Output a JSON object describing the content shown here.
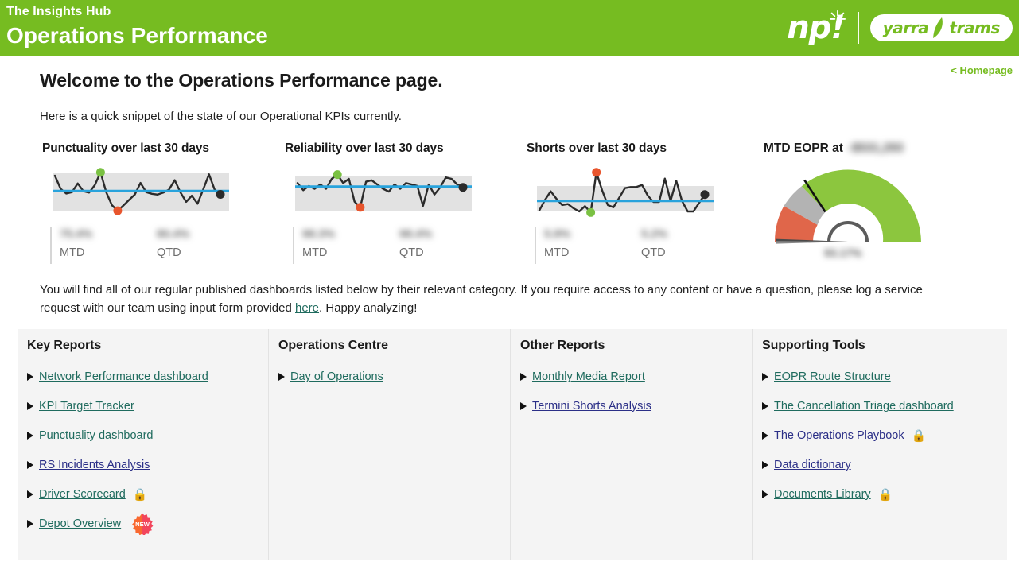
{
  "header": {
    "subtitle": "The Insights Hub",
    "title": "Operations Performance",
    "brand_np": "np",
    "brand_np_bang": "!",
    "brand_yarra": "yarra",
    "brand_trams": "trams",
    "brand_color": "#76bc21"
  },
  "homepage_link": "< Homepage",
  "welcome": {
    "title": "Welcome to the Operations Performance page.",
    "subtitle": "Here is a quick snippet of the state of our Operational KPIs currently."
  },
  "intro": {
    "part1": "You will find all of our regular published dashboards listed below by their relevant category. If you require access to any content or have a question, please log a service request with our team using input form provided ",
    "link": "here",
    "part2": ". Happy analyzing!"
  },
  "kpi_cards": [
    {
      "title": "Punctuality over last 30 days",
      "mtd_value": "75.4%",
      "mtd_label": "MTD",
      "qtd_value": "80.4%",
      "qtd_label": "QTD"
    },
    {
      "title": "Reliability over last 30 days",
      "mtd_value": "98.3%",
      "mtd_label": "MTD",
      "qtd_value": "98.4%",
      "qtd_label": "QTD"
    },
    {
      "title": "Shorts over last 30 days",
      "mtd_value": "5.9%",
      "mtd_label": "MTD",
      "qtd_value": "5.2%",
      "qtd_label": "QTD"
    }
  ],
  "gauge": {
    "title": "MTD EOPR at",
    "amount": "-$531,293",
    "percent": "93.17%"
  },
  "chart_data": [
    {
      "type": "line",
      "title": "Punctuality over last 30 days",
      "xlabel": "",
      "ylabel": "",
      "grid": false,
      "legend": "none",
      "reference_line": 78.5,
      "ylim": [
        70,
        86
      ],
      "x": [
        1,
        2,
        3,
        4,
        5,
        6,
        7,
        8,
        9,
        10,
        11,
        12,
        13,
        14,
        15,
        16,
        17,
        18,
        19,
        20,
        21,
        22,
        23,
        24,
        25,
        26,
        27,
        28,
        29,
        30
      ],
      "values": [
        84.0,
        79.3,
        77.6,
        78.1,
        81.2,
        78.4,
        77.9,
        80.6,
        85.2,
        78.0,
        73.4,
        71.4,
        73.3,
        75.3,
        77.2,
        81.4,
        78.1,
        77.5,
        77.2,
        77.9,
        79.0,
        82.4,
        78.0,
        74.6,
        76.8,
        73.9,
        79.1,
        84.5,
        79.0,
        77.3
      ],
      "markers": {
        "max_index": 9,
        "max_color": "#7ac143",
        "min_index": 12,
        "min_color": "#e8552d",
        "last_index": 30,
        "last_color": "#2b2b2b"
      },
      "mtd": "75.4%",
      "qtd": "80.4%"
    },
    {
      "type": "line",
      "title": "Reliability over last 30 days",
      "xlabel": "",
      "ylabel": "",
      "grid": false,
      "legend": "none",
      "reference_line": 98.35,
      "ylim": [
        96.5,
        99.4
      ],
      "x": [
        1,
        2,
        3,
        4,
        5,
        6,
        7,
        8,
        9,
        10,
        11,
        12,
        13,
        14,
        15,
        16,
        17,
        18,
        19,
        20,
        21,
        22,
        23,
        24,
        25,
        26,
        27,
        28,
        29,
        30
      ],
      "values": [
        98.6,
        98.1,
        98.4,
        98.2,
        98.5,
        98.2,
        98.9,
        99.2,
        98.6,
        98.9,
        97.3,
        96.9,
        98.7,
        98.8,
        98.5,
        98.2,
        98.0,
        98.5,
        98.2,
        98.6,
        98.5,
        98.4,
        97.0,
        98.5,
        97.8,
        98.3,
        99.0,
        98.9,
        98.5,
        98.3
      ],
      "markers": {
        "max_index": 8,
        "max_color": "#7ac143",
        "min_index": 12,
        "min_color": "#e8552d",
        "last_index": 30,
        "last_color": "#2b2b2b"
      },
      "mtd": "98.3%",
      "qtd": "98.4%"
    },
    {
      "type": "line",
      "title": "Shorts over last 30 days",
      "xlabel": "",
      "ylabel": "",
      "grid": false,
      "legend": "none",
      "reference_line": 5.3,
      "ylim": [
        4.0,
        8.2
      ],
      "x": [
        1,
        2,
        3,
        4,
        5,
        6,
        7,
        8,
        9,
        10,
        11,
        12,
        13,
        14,
        15,
        16,
        17,
        18,
        19,
        20,
        21,
        22,
        23,
        24,
        25,
        26,
        27,
        28,
        29,
        30
      ],
      "values": [
        4.4,
        5.4,
        6.2,
        5.5,
        4.9,
        5.0,
        4.6,
        4.3,
        4.8,
        4.2,
        8.0,
        6.3,
        4.9,
        4.7,
        5.6,
        6.5,
        6.6,
        6.6,
        6.8,
        5.8,
        5.2,
        5.2,
        7.4,
        5.3,
        7.2,
        5.3,
        4.3,
        4.3,
        5.1,
        5.9
      ],
      "markers": {
        "max_index": 11,
        "max_color": "#e8552d",
        "min_index": 10,
        "min_color": "#7ac143",
        "last_index": 30,
        "last_color": "#2b2b2b"
      },
      "mtd": "5.9%",
      "qtd": "5.2%"
    },
    {
      "type": "gauge",
      "title": "MTD EOPR at",
      "value_label": "93.17%",
      "amount_label": "-$531,293",
      "segments": [
        {
          "name": "poor",
          "color": "#e0664a",
          "from": 0,
          "to": 13
        },
        {
          "name": "warn",
          "color": "#b3b3b3",
          "from": 13,
          "to": 24
        },
        {
          "name": "good",
          "color": "#8cc63e",
          "from": 24,
          "to": 100
        }
      ],
      "needle_value": 1.5,
      "target_value": 67
    }
  ],
  "columns": [
    {
      "heading": "Key Reports",
      "links": [
        {
          "label": "Network Performance dashboard",
          "style": "green",
          "badge": "none"
        },
        {
          "label": "KPI Target Tracker",
          "style": "green",
          "badge": "none"
        },
        {
          "label": "Punctuality dashboard",
          "style": "green",
          "badge": "none"
        },
        {
          "label": "RS Incidents Analysis",
          "style": "navy",
          "badge": "none"
        },
        {
          "label": "Driver Scorecard",
          "style": "green",
          "badge": "lock"
        },
        {
          "label": "Depot Overview",
          "style": "green",
          "badge": "new"
        }
      ]
    },
    {
      "heading": "Operations Centre",
      "links": [
        {
          "label": "Day of Operations",
          "style": "green",
          "badge": "none"
        }
      ]
    },
    {
      "heading": "Other Reports",
      "links": [
        {
          "label": "Monthly Media Report",
          "style": "green",
          "badge": "none"
        },
        {
          "label": "Termini Shorts Analysis",
          "style": "navy",
          "badge": "none"
        }
      ]
    },
    {
      "heading": "Supporting Tools",
      "links": [
        {
          "label": "EOPR Route Structure",
          "style": "green",
          "badge": "none"
        },
        {
          "label": "The Cancellation Triage dashboard",
          "style": "green",
          "badge": "none"
        },
        {
          "label": "The Operations Playbook",
          "style": "navy",
          "badge": "lock"
        },
        {
          "label": "Data dictionary",
          "style": "navy",
          "badge": "none"
        },
        {
          "label": "Documents Library",
          "style": "green",
          "badge": "lock"
        }
      ]
    }
  ],
  "icons": {
    "lock": "🔒",
    "new": "NEW",
    "bullet": "play-triangle"
  }
}
